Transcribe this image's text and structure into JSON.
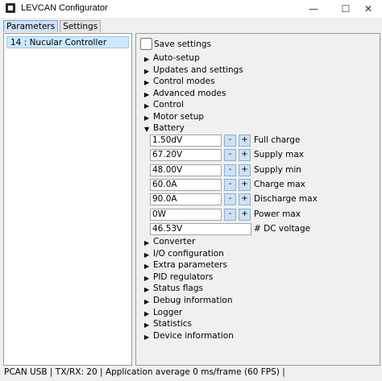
{
  "window": {
    "title": "LEVCAN Configurator",
    "minimize": "—",
    "maximize": "☐",
    "close": "✕"
  },
  "tabs": [
    {
      "label": "Parameters"
    },
    {
      "label": "Settings"
    }
  ],
  "devices": [
    {
      "label": "14 : Nucular Controller"
    }
  ],
  "save_settings": {
    "label": "Save settings"
  },
  "groups_top": [
    "Auto-setup",
    "Updates and settings",
    "Control modes",
    "Advanced modes",
    "Control",
    "Motor setup"
  ],
  "battery": {
    "label": "Battery",
    "fields": [
      {
        "value": "1.50dV",
        "label": "Full charge"
      },
      {
        "value": "67.20V",
        "label": "Supply max"
      },
      {
        "value": "48.00V",
        "label": "Supply min"
      },
      {
        "value": "60.0A",
        "label": "Charge max"
      },
      {
        "value": "90.0A",
        "label": "Discharge max"
      },
      {
        "value": "0W",
        "label": "Power max"
      }
    ],
    "dc_voltage": {
      "value": "46.53V",
      "label": "# DC voltage"
    },
    "minus": "-",
    "plus": "+"
  },
  "groups_bottom": [
    "Converter",
    "I/O configuration",
    "Extra parameters",
    "PID regulators",
    "Status flags",
    "Debug information",
    "Logger",
    "Statistics",
    "Device information"
  ],
  "status": "PCAN USB | TX/RX: 20 | Application average 0 ms/frame (60 FPS) |"
}
